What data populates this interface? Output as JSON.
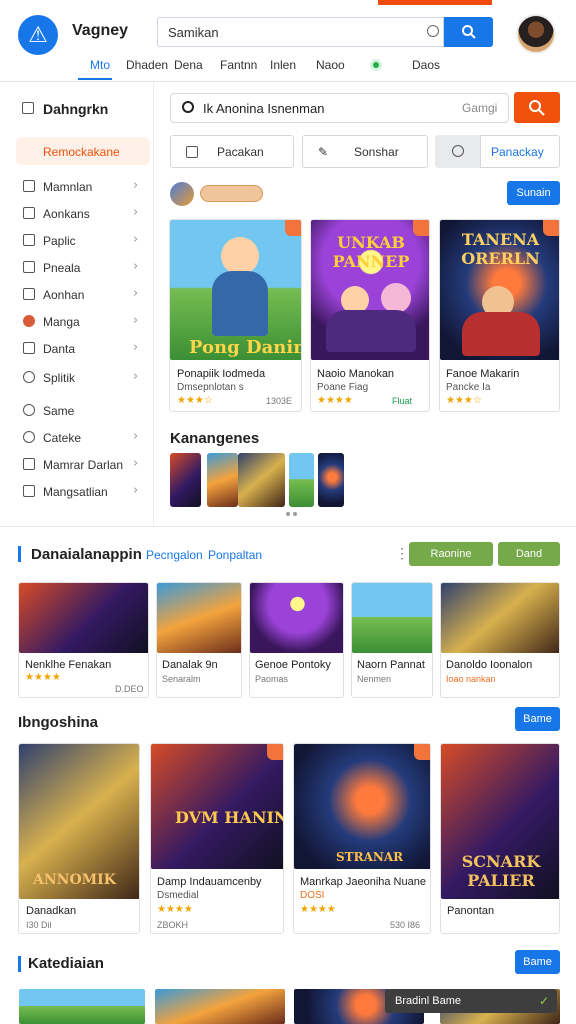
{
  "header": {
    "brand": "Vagney",
    "search_value": "Samikan",
    "nav": [
      "Mto",
      "Dhaden",
      "Dena",
      "Fantnn",
      "Inlen",
      "Naoo",
      "Daos"
    ]
  },
  "sidebar": {
    "title": "Dahngrkn",
    "items": [
      "Remockakane",
      "Mamnlan",
      "Aonkans",
      "Paplic",
      "Pneala",
      "Aonhan",
      "Manga",
      "Danta",
      "Splitik",
      "Same",
      "Cateke",
      "Mamrar Darlan",
      "Mangsatlian"
    ]
  },
  "main": {
    "search_text": "Ik Anonina Isnenman",
    "search_hint": "Gamgi",
    "filters": [
      "Pacakan",
      "Sonshar",
      "Panackay"
    ],
    "promo_button": "Sunain",
    "cards": [
      {
        "title": "Ponapiik Iodmeda",
        "sub": "Dmsepnlotan s",
        "meta": "1303E",
        "art_text": "Pong Danin"
      },
      {
        "title": "Naoio Manokan",
        "sub": "Poane Fiag",
        "meta": "Fluat",
        "art_text": "UNKAB PANNEP"
      },
      {
        "title": "Fanoe Makarin",
        "sub": "Pancke Ia",
        "meta": "",
        "art_text": "TANENA ORERLN"
      }
    ],
    "mini_title": "Kanangenes"
  },
  "section1": {
    "title": "Danaialanappin",
    "links": [
      "Pecngalon",
      "Ponpaltan"
    ],
    "buttons": [
      "Raonine",
      "Dand"
    ],
    "cards": [
      {
        "title": "Nenklhe Fenakan",
        "meta": "D.DEO"
      },
      {
        "title": "Danalak 9n",
        "meta": "Senaralm"
      },
      {
        "title": "Genoe Pontoky",
        "meta": "Paomas"
      },
      {
        "title": "Naorn Pannat",
        "meta": "Nenmen"
      },
      {
        "title": "Danoldo Ioonalon",
        "meta": "Ioao nankan"
      }
    ]
  },
  "section2": {
    "title": "Ibngoshina",
    "button": "Bame",
    "cards": [
      {
        "title": "Danadkan",
        "meta": "I30 Dil",
        "art": "ANNOMIK"
      },
      {
        "title": "Damp Indauamcenby",
        "sub": "Dsmedial",
        "meta": "ZBOKH",
        "art": "DVM HANIN"
      },
      {
        "title": "Manrkap Jaeoniha Nuane",
        "sub": "DOSI",
        "meta": "530 I86",
        "art": "STRANAR"
      },
      {
        "title": "Panontan",
        "meta": "",
        "art": "SCNARK PALIER"
      }
    ]
  },
  "section3": {
    "title": "Katediaian",
    "button": "Bame"
  },
  "popup": {
    "text": "Bradinl Bame"
  }
}
